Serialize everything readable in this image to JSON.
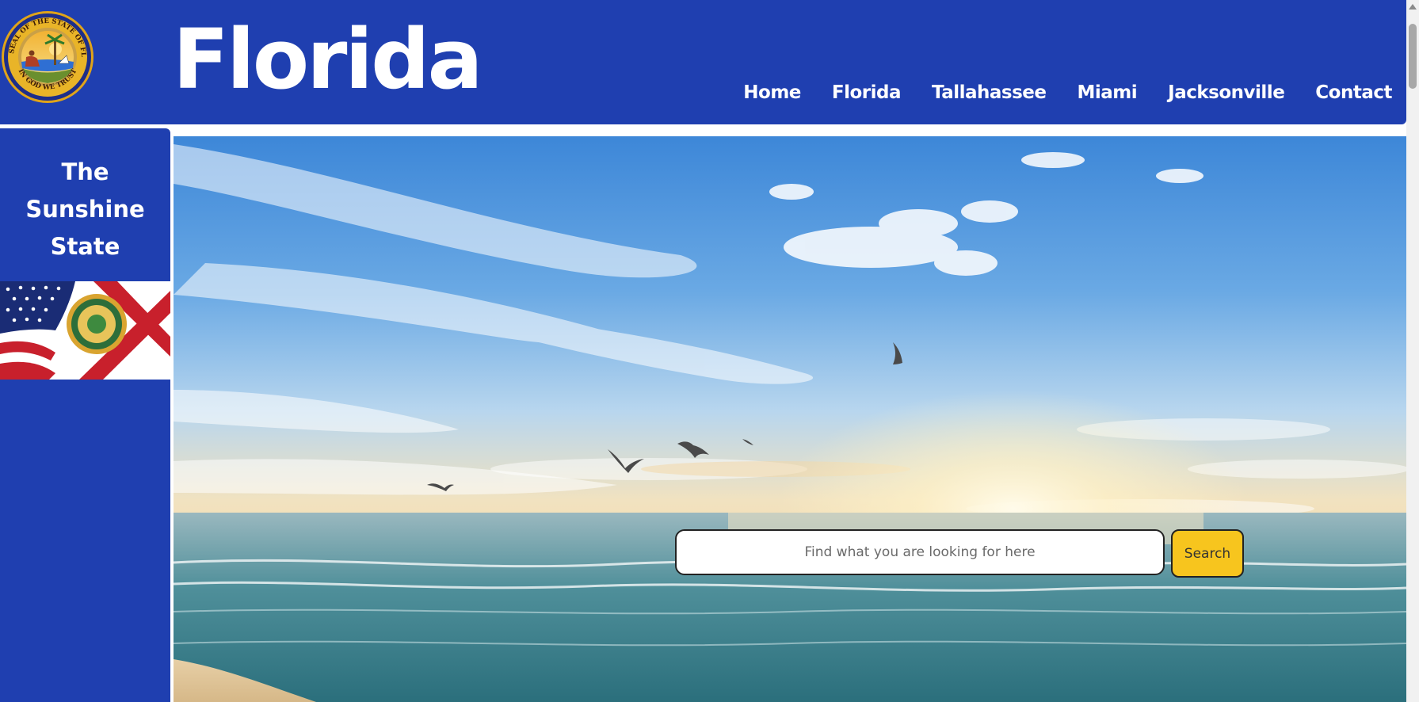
{
  "header": {
    "title": "Florida",
    "seal_icon": "florida-state-seal-icon",
    "seal_text_top": "GREAT SEAL OF THE STATE OF FLORIDA",
    "seal_text_bottom": "IN GOD WE TRUST",
    "nav": [
      "Home",
      "Florida",
      "Tallahassee",
      "Miami",
      "Jacksonville",
      "Contact"
    ]
  },
  "sidebar": {
    "tagline": [
      "The",
      "Sunshine",
      "State"
    ],
    "flag_icon": "us-florida-flag-image"
  },
  "hero": {
    "image": "beach-sunset-seagulls-image",
    "search_placeholder": "Find what you are looking for here",
    "search_button": "Search"
  },
  "colors": {
    "brand_blue": "#1f3fb0",
    "search_button_yellow": "#f7c51e",
    "white": "#ffffff"
  }
}
